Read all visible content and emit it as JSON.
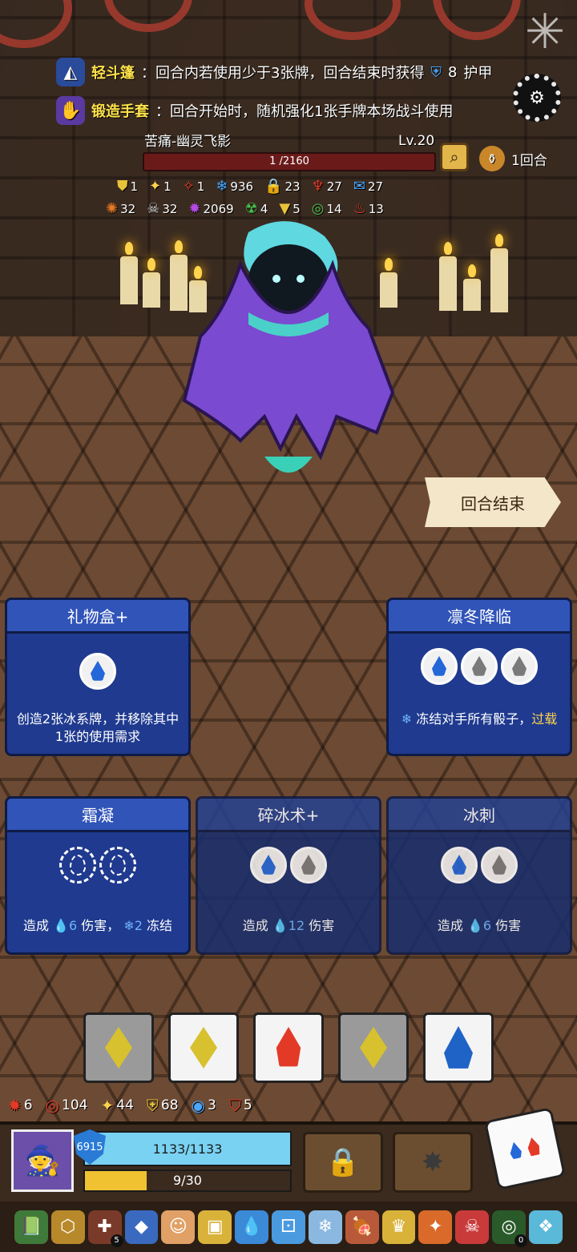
{
  "buffs": [
    {
      "label": "轻斗篷",
      "text": "：回合内若使用少于3张牌，回合结束时获得",
      "value": "8",
      "suffix": "护甲",
      "icon": "cloak-icon"
    },
    {
      "label": "锻造手套",
      "text": "：回合开始时，随机强化1张手牌本场战斗使用",
      "icon": "gauntlet-icon"
    }
  ],
  "boss": {
    "name": "苦痛-幽灵飞影",
    "level": "Lv.20",
    "hp_text": "1 /2160",
    "hp_fraction": 0.0005,
    "turns": "1回合"
  },
  "boss_stats_row1": [
    {
      "icon": "armor-icon",
      "value": "1",
      "color": "#e8c33a"
    },
    {
      "icon": "spark-icon",
      "value": "1",
      "color": "#ffd34d"
    },
    {
      "icon": "claw-icon",
      "value": "1",
      "color": "#e33a27"
    },
    {
      "icon": "snowflake-icon",
      "value": "936",
      "color": "#4aa7ff"
    },
    {
      "icon": "lock-icon",
      "value": "23",
      "color": "#e8c33a"
    },
    {
      "icon": "demon-icon",
      "value": "27",
      "color": "#e33a27"
    },
    {
      "icon": "speech-icon",
      "value": "27",
      "color": "#4aa7ff"
    }
  ],
  "boss_stats_row2": [
    {
      "icon": "fire-slash-icon",
      "value": "32",
      "color": "#e37a27"
    },
    {
      "icon": "skull-icon",
      "value": "32",
      "color": "#dddddd"
    },
    {
      "icon": "burst-icon",
      "value": "2069",
      "color": "#b44ae0"
    },
    {
      "icon": "poison-icon",
      "value": "4",
      "color": "#4ac04a"
    },
    {
      "icon": "triangle-icon",
      "value": "5",
      "color": "#e8c33a"
    },
    {
      "icon": "spiral-icon",
      "value": "14",
      "color": "#4ac04a"
    },
    {
      "icon": "flame-icon",
      "value": "13",
      "color": "#e33a27"
    }
  ],
  "end_turn_label": "回合结束",
  "cards": [
    {
      "title": "礼物盒+",
      "desc": "创造2张冰系牌，并移除其中1张的使用需求"
    },
    {
      "title": "凛冬降临",
      "desc_pre": "冻结对手所有骰子，",
      "desc_warn": "过载"
    },
    {
      "title": "霜凝",
      "desc_a": "造成",
      "desc_dmg": "6",
      "desc_b": "伤害，",
      "desc_freeze": "2",
      "desc_c": "冻结"
    },
    {
      "title": "碎冰术+",
      "desc_a": "造成",
      "desc_dmg": "12",
      "desc_b": "伤害"
    },
    {
      "title": "冰刺",
      "desc_a": "造成",
      "desc_dmg": "6",
      "desc_b": "伤害"
    }
  ],
  "dice": [
    {
      "face": "diamond",
      "bg": "#9a9a9a"
    },
    {
      "face": "diamond",
      "bg": "#f4f4f4"
    },
    {
      "face": "flame",
      "bg": "#f4f4f4"
    },
    {
      "face": "diamond",
      "bg": "#9a9a9a"
    },
    {
      "face": "drop",
      "bg": "#f4f4f4"
    }
  ],
  "player_stats": [
    {
      "icon": "burst-icon",
      "value": "6",
      "color": "#e33a27"
    },
    {
      "icon": "spiral-icon",
      "value": "104",
      "color": "#e33a27"
    },
    {
      "icon": "spark-icon",
      "value": "44",
      "color": "#ffd34d"
    },
    {
      "icon": "shield-icon",
      "value": "68",
      "color": "#e8c33a"
    },
    {
      "icon": "vortex-icon",
      "value": "3",
      "color": "#4aa7ff"
    },
    {
      "icon": "shield-slash-icon",
      "value": "5",
      "color": "#e33a27"
    }
  ],
  "player": {
    "shield": "6915",
    "hp_text": "1133/1133",
    "energy_text": "9/30",
    "energy_fraction": 0.3
  },
  "relics": [
    {
      "name": "green-book-icon",
      "glyph": "📗",
      "bg": "#3f7a3a"
    },
    {
      "name": "gold-hex-icon",
      "glyph": "⬡",
      "bg": "#b8892b"
    },
    {
      "name": "cross-shield-icon",
      "glyph": "✚",
      "bg": "#7a3a2a",
      "badge": "5"
    },
    {
      "name": "blue-block-icon",
      "glyph": "◆",
      "bg": "#3a6ac0"
    },
    {
      "name": "face-coin-icon",
      "glyph": "☺",
      "bg": "#e0a066"
    },
    {
      "name": "gold-box-icon",
      "glyph": "▣",
      "bg": "#d9b23a"
    },
    {
      "name": "water-drop-icon",
      "glyph": "💧",
      "bg": "#3a8ad8"
    },
    {
      "name": "blue-die-icon",
      "glyph": "⚀",
      "bg": "#4a9ae0"
    },
    {
      "name": "ice-shard-icon",
      "glyph": "❄",
      "bg": "#8ab8e0"
    },
    {
      "name": "meat-icon",
      "glyph": "🍖",
      "bg": "#b85a3a"
    },
    {
      "name": "crown-icon",
      "glyph": "♛",
      "bg": "#d9b23a"
    },
    {
      "name": "fire-gem-icon",
      "glyph": "✦",
      "bg": "#d96a2a"
    },
    {
      "name": "mask-icon",
      "glyph": "☠",
      "bg": "#c93a3a"
    },
    {
      "name": "wreath-icon",
      "glyph": "◎",
      "bg": "#2a5a2a",
      "badge": "0"
    },
    {
      "name": "ice-crystal-icon",
      "glyph": "❖",
      "bg": "#5ab8d8"
    }
  ]
}
